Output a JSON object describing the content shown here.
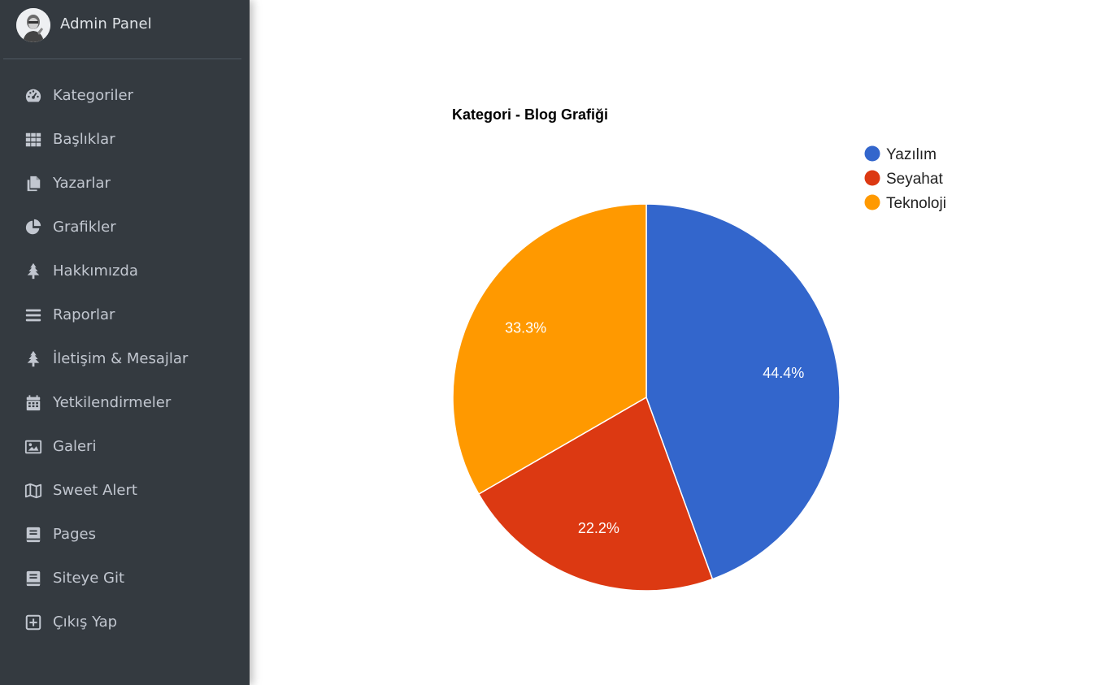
{
  "sidebar": {
    "brand": {
      "title": "Admin Panel"
    },
    "items": [
      {
        "label": "Kategoriler",
        "icon": "tachometer-icon"
      },
      {
        "label": "Başlıklar",
        "icon": "grid-icon"
      },
      {
        "label": "Yazarlar",
        "icon": "copy-icon"
      },
      {
        "label": "Grafikler",
        "icon": "pie-chart-icon"
      },
      {
        "label": "Hakkımızda",
        "icon": "tree-icon"
      },
      {
        "label": "Raporlar",
        "icon": "bars-icon"
      },
      {
        "label": "İletişim & Mesajlar",
        "icon": "tree-icon"
      },
      {
        "label": "Yetkilendirmeler",
        "icon": "calendar-icon"
      },
      {
        "label": "Galeri",
        "icon": "image-icon"
      },
      {
        "label": "Sweet Alert",
        "icon": "map-icon"
      },
      {
        "label": "Pages",
        "icon": "book-icon"
      },
      {
        "label": "Siteye Git",
        "icon": "book-icon"
      },
      {
        "label": "Çıkış Yap",
        "icon": "plus-square-icon"
      }
    ]
  },
  "chart_data": {
    "type": "pie",
    "title": "Kategori - Blog Grafiği",
    "categories": [
      "Yazılım",
      "Seyahat",
      "Teknoloji"
    ],
    "values": [
      44.4,
      22.2,
      33.3
    ],
    "data_labels": [
      "44.4%",
      "22.2%",
      "33.3%"
    ],
    "colors": [
      "#3366cc",
      "#dc3912",
      "#ff9900"
    ],
    "legend": "top-right"
  }
}
